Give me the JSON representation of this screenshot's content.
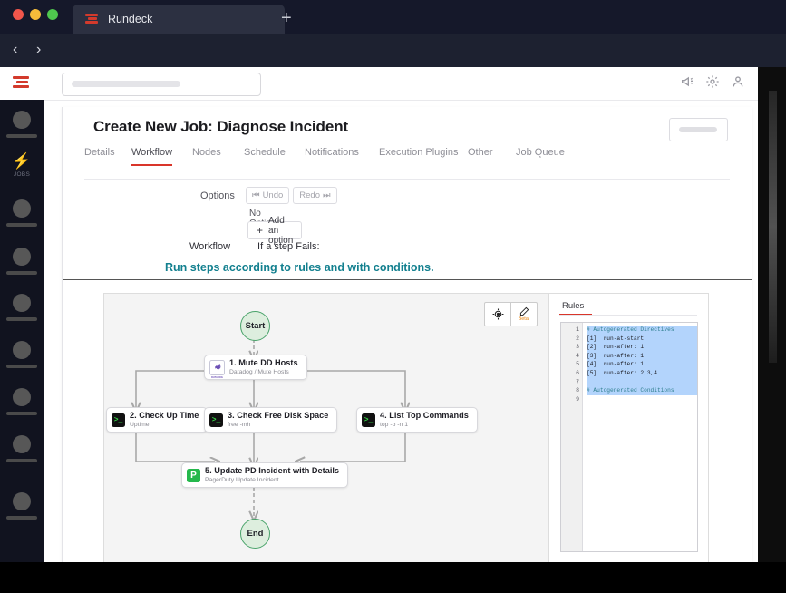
{
  "browser": {
    "tab_title": "Rundeck",
    "new_tab_label": "+",
    "back_label": "‹",
    "forward_label": "›",
    "url_value": ""
  },
  "app_header": {
    "search_placeholder": "",
    "icons": [
      "megaphone-icon",
      "gear-icon",
      "user-icon"
    ]
  },
  "rail": {
    "jobs_label": "JOBS"
  },
  "page": {
    "title": "Create New Job: Diagnose Incident"
  },
  "tabs": [
    {
      "label": "Details",
      "active": false
    },
    {
      "label": "Workflow",
      "active": true
    },
    {
      "label": "Nodes",
      "active": false
    },
    {
      "label": "Schedule",
      "active": false
    },
    {
      "label": "Notifications",
      "active": false
    },
    {
      "label": "Execution Plugins",
      "active": false
    },
    {
      "label": "Other",
      "active": false
    },
    {
      "label": "Job Queue",
      "active": false
    }
  ],
  "options": {
    "label": "Options",
    "undo_label": "Undo",
    "redo_label": "Redo",
    "undo_glyph": "⏮",
    "redo_glyph": "⏭",
    "no_options_text": "No Options",
    "add_option_label": "Add an option",
    "add_option_glyph": "+"
  },
  "workflow": {
    "label": "Workflow",
    "strategy_label": "If a step Fails:",
    "description": "Run steps according to rules and with conditions.",
    "tools": {
      "focus_icon": "crosshair-target-icon",
      "edit_icon": "pencil-icon",
      "beta_label": "Beta!"
    },
    "start_node": "Start",
    "end_node": "End",
    "steps": [
      {
        "title": "1. Mute DD Hosts",
        "subtitle": "Datadog / Mute Hosts",
        "icon": "datadog-icon",
        "glyph": "🐶",
        "icon_caption": "DATADOG"
      },
      {
        "title": "2. Check Up Time",
        "subtitle": "Uptime",
        "icon": "terminal-icon",
        "glyph": ">_"
      },
      {
        "title": "3. Check Free Disk Space",
        "subtitle": "free -mh",
        "icon": "terminal-icon",
        "glyph": ">_"
      },
      {
        "title": "4. List Top Commands",
        "subtitle": "top -b -n 1",
        "icon": "terminal-icon",
        "glyph": ">_"
      },
      {
        "title": "5. Update PD Incident with Details",
        "subtitle": "PagerDuty Update Incident",
        "icon": "pagerduty-icon",
        "glyph": "P"
      }
    ]
  },
  "rules_panel": {
    "tab_label": "Rules",
    "line_numbers": [
      "1",
      "2",
      "3",
      "4",
      "5",
      "6",
      "7",
      "8",
      "9"
    ],
    "lines": [
      {
        "text": "# Autogenerated Directives",
        "kind": "comment",
        "selected": true
      },
      {
        "text": "[1]  run-at-start",
        "kind": "rule",
        "selected": true
      },
      {
        "text": "[2]  run-after: 1",
        "kind": "rule",
        "selected": true
      },
      {
        "text": "[3]  run-after: 1",
        "kind": "rule",
        "selected": true
      },
      {
        "text": "[4]  run-after: 1",
        "kind": "rule",
        "selected": true
      },
      {
        "text": "[5]  run-after: 2,3,4",
        "kind": "rule",
        "selected": true
      },
      {
        "text": "",
        "kind": "blank",
        "selected": true
      },
      {
        "text": "# Autogenerated Conditions",
        "kind": "comment",
        "selected": true
      },
      {
        "text": "",
        "kind": "blank",
        "selected": false
      }
    ]
  },
  "colors": {
    "accent_red": "#d9352a",
    "teal": "#13808f",
    "node_green_border": "#49a36a",
    "node_green_fill": "#ddeede",
    "terminal_green": "#3ad94a",
    "pagerduty_green": "#25b84c",
    "datadog_purple": "#6c4fb5",
    "beta_orange": "#e8820c",
    "editor_selection": "#b3d4fc"
  }
}
